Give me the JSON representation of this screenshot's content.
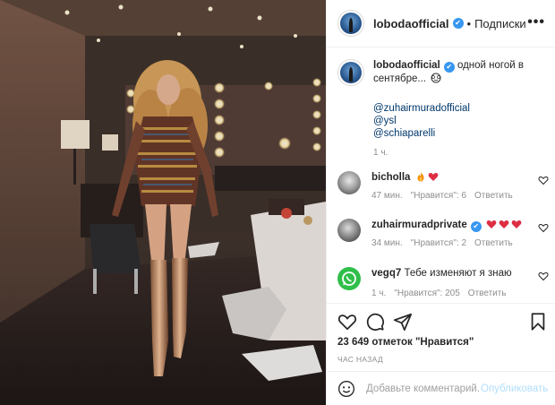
{
  "post": {
    "author": "lobodaofficial",
    "verified_glyph": "✔",
    "separator": "•",
    "follow_label": "Подписки",
    "more_label": "•••",
    "caption_text": "одной ногой в сентябре...",
    "mentions": [
      "@zuhairmuradofficial",
      "@ysl",
      "@schiaparelli"
    ],
    "caption_time": "1 ч."
  },
  "comments": [
    {
      "username": "bicholla",
      "text": "",
      "emoji": [
        "fire-emoji",
        "red-heart-emoji"
      ],
      "time": "47 мин.",
      "likes": "\"Нравится\": 6",
      "reply": "Ответить"
    },
    {
      "username": "zuhairmuradprivate",
      "verified": true,
      "text": "",
      "emoji": [
        "red-heart-emoji",
        "red-heart-emoji",
        "red-heart-emoji"
      ],
      "time": "34 мин.",
      "likes": "\"Нравится\": 2",
      "reply": "Ответить"
    },
    {
      "username": "vegq7",
      "text": "Тебе изменяют я знаю",
      "time": "1 ч.",
      "likes": "\"Нравится\": 205",
      "reply": "Ответить"
    }
  ],
  "actions": {
    "icons": [
      "heart-icon",
      "comment-icon",
      "share-icon",
      "bookmark-icon"
    ]
  },
  "likes_summary": "23 649 отметок \"Нравится\"",
  "post_age": "ЧАС НАЗАД",
  "add_comment": {
    "placeholder": "Добавьте комментарий...",
    "publish_label": "Опубликовать"
  },
  "colors": {
    "link": "#00376b",
    "verified": "#3897f0",
    "muted": "#8e8e8e",
    "publish_disabled": "#b2dffc",
    "heart_red": "#ed4956"
  }
}
